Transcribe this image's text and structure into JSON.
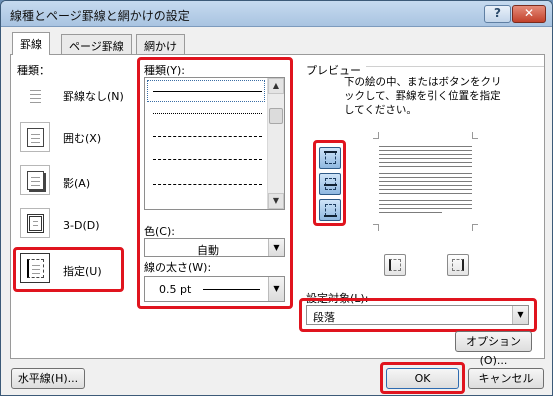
{
  "window": {
    "title": "線種とページ罫線と網かけの設定",
    "help_glyph": "?",
    "close_glyph": "✕"
  },
  "tabs": [
    {
      "label": "罫線",
      "active": true
    },
    {
      "label": "ページ罫線",
      "active": false
    },
    {
      "label": "網かけ",
      "active": false
    }
  ],
  "presets": {
    "heading": "種類：",
    "items": [
      {
        "label": "罫線なし(N)"
      },
      {
        "label": "囲む(X)"
      },
      {
        "label": "影(A)"
      },
      {
        "label": "3-D(D)"
      },
      {
        "label": "指定(U)"
      }
    ]
  },
  "style": {
    "heading": "種類(Y):",
    "color_label": "色(C):",
    "color_value": "自動",
    "width_label": "線の太さ(W):",
    "width_value": "0.5 pt"
  },
  "preview": {
    "heading": "プレビュー",
    "instruction": "下の絵の中、またはボタンをクリックして、罫線を引く位置を指定してください。",
    "apply_label": "設定対象(L):",
    "apply_value": "段落",
    "options_button": "オプション(O)..."
  },
  "footer": {
    "horizontal_line_button": "水平線(H)...",
    "ok_button": "OK",
    "cancel_button": "キャンセル"
  },
  "icons": {
    "dropdown": "▼",
    "scroll_up": "▲",
    "scroll_down": "▼"
  },
  "colors": {
    "highlight": "#e0141e",
    "title_gradient_top": "#c6daef"
  }
}
